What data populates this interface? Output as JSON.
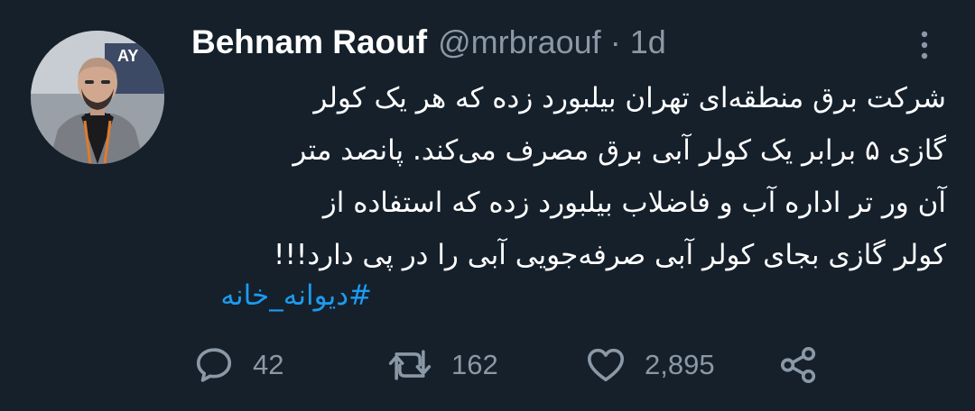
{
  "tweet": {
    "author": {
      "display_name": "Behnam Raouf",
      "handle": "@mrbraouf",
      "separator": "·",
      "time": "1d",
      "avatar_text": "AY"
    },
    "text_lines": [
      "شرکت برق منطقه‌ای تهران بیلبورد زده که هر یک کولر",
      "گازی ۵ برابر یک کولر آبی برق مصرف می‌کند. پانصد متر",
      "آن ور تر اداره آب و فاضلاب بیلبورد زده که استفاده از",
      "کولر گازی بجای کولر آبی صرفه‌جویی آبی را در پی دارد!!!"
    ],
    "hashtag": "#دیوانه_خانه",
    "actions": {
      "reply_count": "42",
      "retweet_count": "162",
      "like_count": "2,895"
    },
    "icons": {
      "more": "more-vertical-icon",
      "reply": "reply-icon",
      "retweet": "retweet-icon",
      "like": "heart-icon",
      "share": "share-icon"
    },
    "colors": {
      "background": "#15202b",
      "primary_text": "#ffffff",
      "secondary_text": "#8b98a5",
      "link": "#1d9bf0"
    }
  }
}
